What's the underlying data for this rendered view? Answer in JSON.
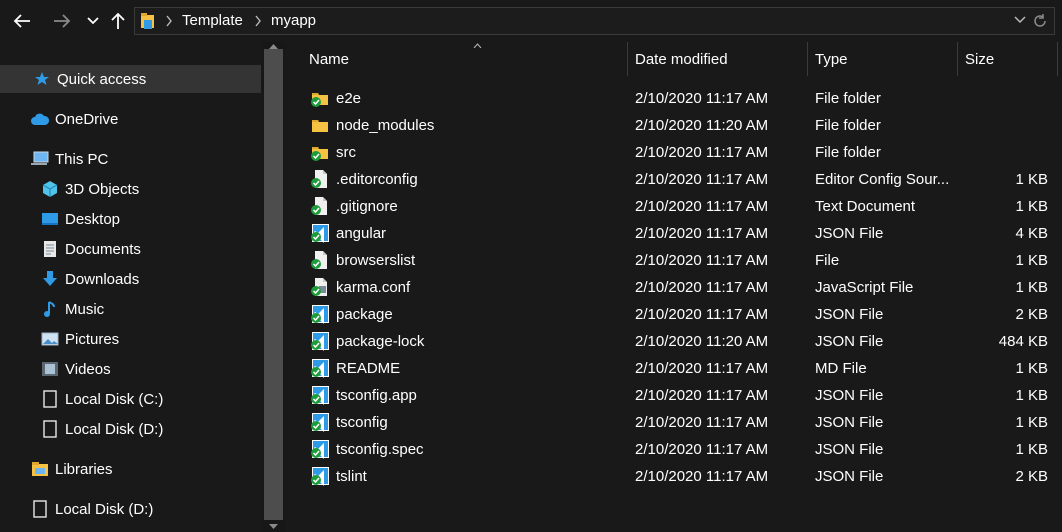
{
  "window": {
    "breadcrumb": [
      "Template",
      "myapp"
    ]
  },
  "toolbar": {
    "back_icon": "arrow-left-icon",
    "forward_icon": "arrow-right-icon",
    "recent_icon": "chevron-down-icon",
    "up_icon": "arrow-up-icon",
    "refresh_icon": "refresh-icon"
  },
  "sidebar": {
    "quick_access": "Quick access",
    "onedrive": "OneDrive",
    "this_pc": "This PC",
    "pc_items": [
      "3D Objects",
      "Desktop",
      "Documents",
      "Downloads",
      "Music",
      "Pictures",
      "Videos",
      "Local Disk (C:)",
      "Local Disk (D:)"
    ],
    "libraries": "Libraries",
    "local_disk_d": "Local Disk (D:)"
  },
  "columns": {
    "name": "Name",
    "date": "Date modified",
    "type": "Type",
    "size": "Size"
  },
  "files": [
    {
      "name": "e2e",
      "date": "2/10/2020 11:17 AM",
      "type": "File folder",
      "size": "",
      "icon": "folder-synced-icon"
    },
    {
      "name": "node_modules",
      "date": "2/10/2020 11:20 AM",
      "type": "File folder",
      "size": "",
      "icon": "folder-icon"
    },
    {
      "name": "src",
      "date": "2/10/2020 11:17 AM",
      "type": "File folder",
      "size": "",
      "icon": "folder-synced-icon"
    },
    {
      "name": ".editorconfig",
      "date": "2/10/2020 11:17 AM",
      "type": "Editor Config Sour...",
      "size": "1 KB",
      "icon": "file-synced-icon"
    },
    {
      "name": ".gitignore",
      "date": "2/10/2020 11:17 AM",
      "type": "Text Document",
      "size": "1 KB",
      "icon": "file-synced-icon"
    },
    {
      "name": "angular",
      "date": "2/10/2020 11:17 AM",
      "type": "JSON File",
      "size": "4 KB",
      "icon": "vscode-file-icon"
    },
    {
      "name": "browserslist",
      "date": "2/10/2020 11:17 AM",
      "type": "File",
      "size": "1 KB",
      "icon": "file-synced-icon"
    },
    {
      "name": "karma.conf",
      "date": "2/10/2020 11:17 AM",
      "type": "JavaScript File",
      "size": "1 KB",
      "icon": "js-file-icon"
    },
    {
      "name": "package",
      "date": "2/10/2020 11:17 AM",
      "type": "JSON File",
      "size": "2 KB",
      "icon": "vscode-file-icon"
    },
    {
      "name": "package-lock",
      "date": "2/10/2020 11:20 AM",
      "type": "JSON File",
      "size": "484 KB",
      "icon": "vscode-file-icon"
    },
    {
      "name": "README",
      "date": "2/10/2020 11:17 AM",
      "type": "MD File",
      "size": "1 KB",
      "icon": "vscode-file-icon"
    },
    {
      "name": "tsconfig.app",
      "date": "2/10/2020 11:17 AM",
      "type": "JSON File",
      "size": "1 KB",
      "icon": "vscode-file-icon"
    },
    {
      "name": "tsconfig",
      "date": "2/10/2020 11:17 AM",
      "type": "JSON File",
      "size": "1 KB",
      "icon": "vscode-file-icon"
    },
    {
      "name": "tsconfig.spec",
      "date": "2/10/2020 11:17 AM",
      "type": "JSON File",
      "size": "1 KB",
      "icon": "vscode-file-icon"
    },
    {
      "name": "tslint",
      "date": "2/10/2020 11:17 AM",
      "type": "JSON File",
      "size": "2 KB",
      "icon": "vscode-file-icon"
    }
  ],
  "colors": {
    "background": "#191919",
    "selected": "#343434",
    "folder": "#f5c244",
    "sync_green": "#1e9b3a",
    "accent_blue": "#2f9be6"
  }
}
